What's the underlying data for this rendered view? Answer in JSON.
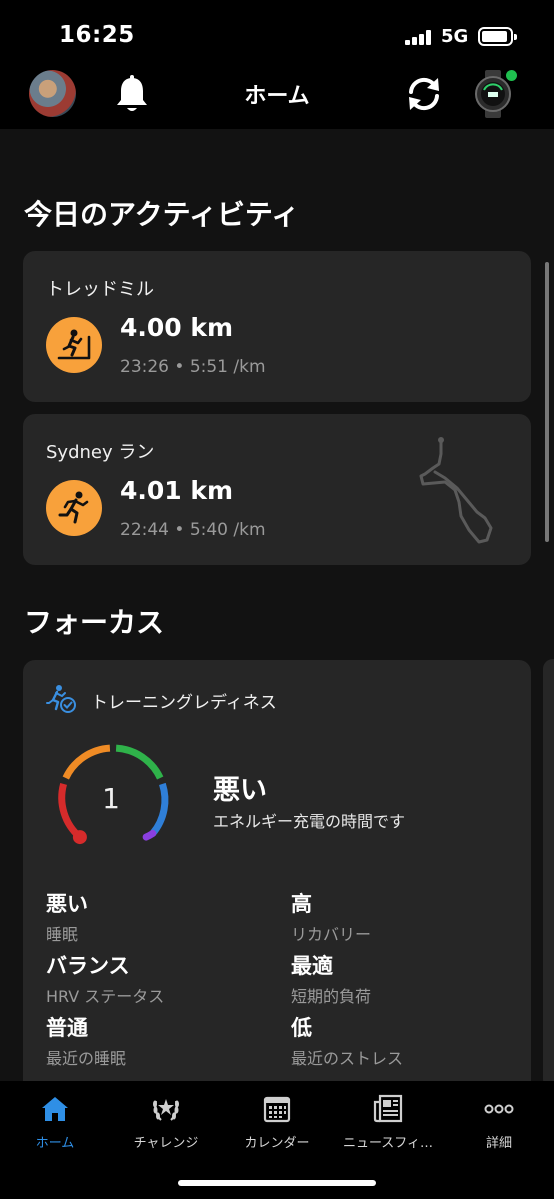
{
  "status_bar": {
    "time": "16:25",
    "network": "5G"
  },
  "nav": {
    "title": "ホーム",
    "icons": [
      "avatar",
      "bell-icon",
      "sync-icon",
      "watch-icon"
    ]
  },
  "today": {
    "section_title": "今日のアクティビティ",
    "activities": [
      {
        "title": "トレッドミル",
        "icon": "treadmill-icon",
        "distance": "4.00 km",
        "meta": "23:26 • 5:51 /km"
      },
      {
        "title": "Sydney ラン",
        "icon": "run-icon",
        "distance": "4.01 km",
        "meta": "22:44 • 5:40 /km"
      }
    ]
  },
  "focus": {
    "section_title": "フォーカス",
    "readiness": {
      "title": "トレーニングレディネス",
      "value": "1",
      "status": "悪い",
      "message": "エネルギー充電の時間です",
      "metrics": [
        {
          "value": "悪い",
          "label": "睡眠"
        },
        {
          "value": "高",
          "label": "リカバリー"
        },
        {
          "value": "バランス",
          "label": "HRV ステータス"
        },
        {
          "value": "最適",
          "label": "短期的負荷"
        },
        {
          "value": "普通",
          "label": "最近の睡眠"
        },
        {
          "value": "低",
          "label": "最近のストレス"
        }
      ]
    }
  },
  "tabs": [
    {
      "label": "ホーム",
      "icon": "home-icon",
      "active": true
    },
    {
      "label": "チャレンジ",
      "icon": "laurel-icon"
    },
    {
      "label": "カレンダー",
      "icon": "calendar-icon"
    },
    {
      "label": "ニュースフィ…",
      "icon": "news-icon"
    },
    {
      "label": "詳細",
      "icon": "more-icon"
    }
  ],
  "colors": {
    "accent": "#2f8fe6",
    "activity_orange": "#f8a13b",
    "card_bg": "#262626",
    "background": "#121212"
  }
}
